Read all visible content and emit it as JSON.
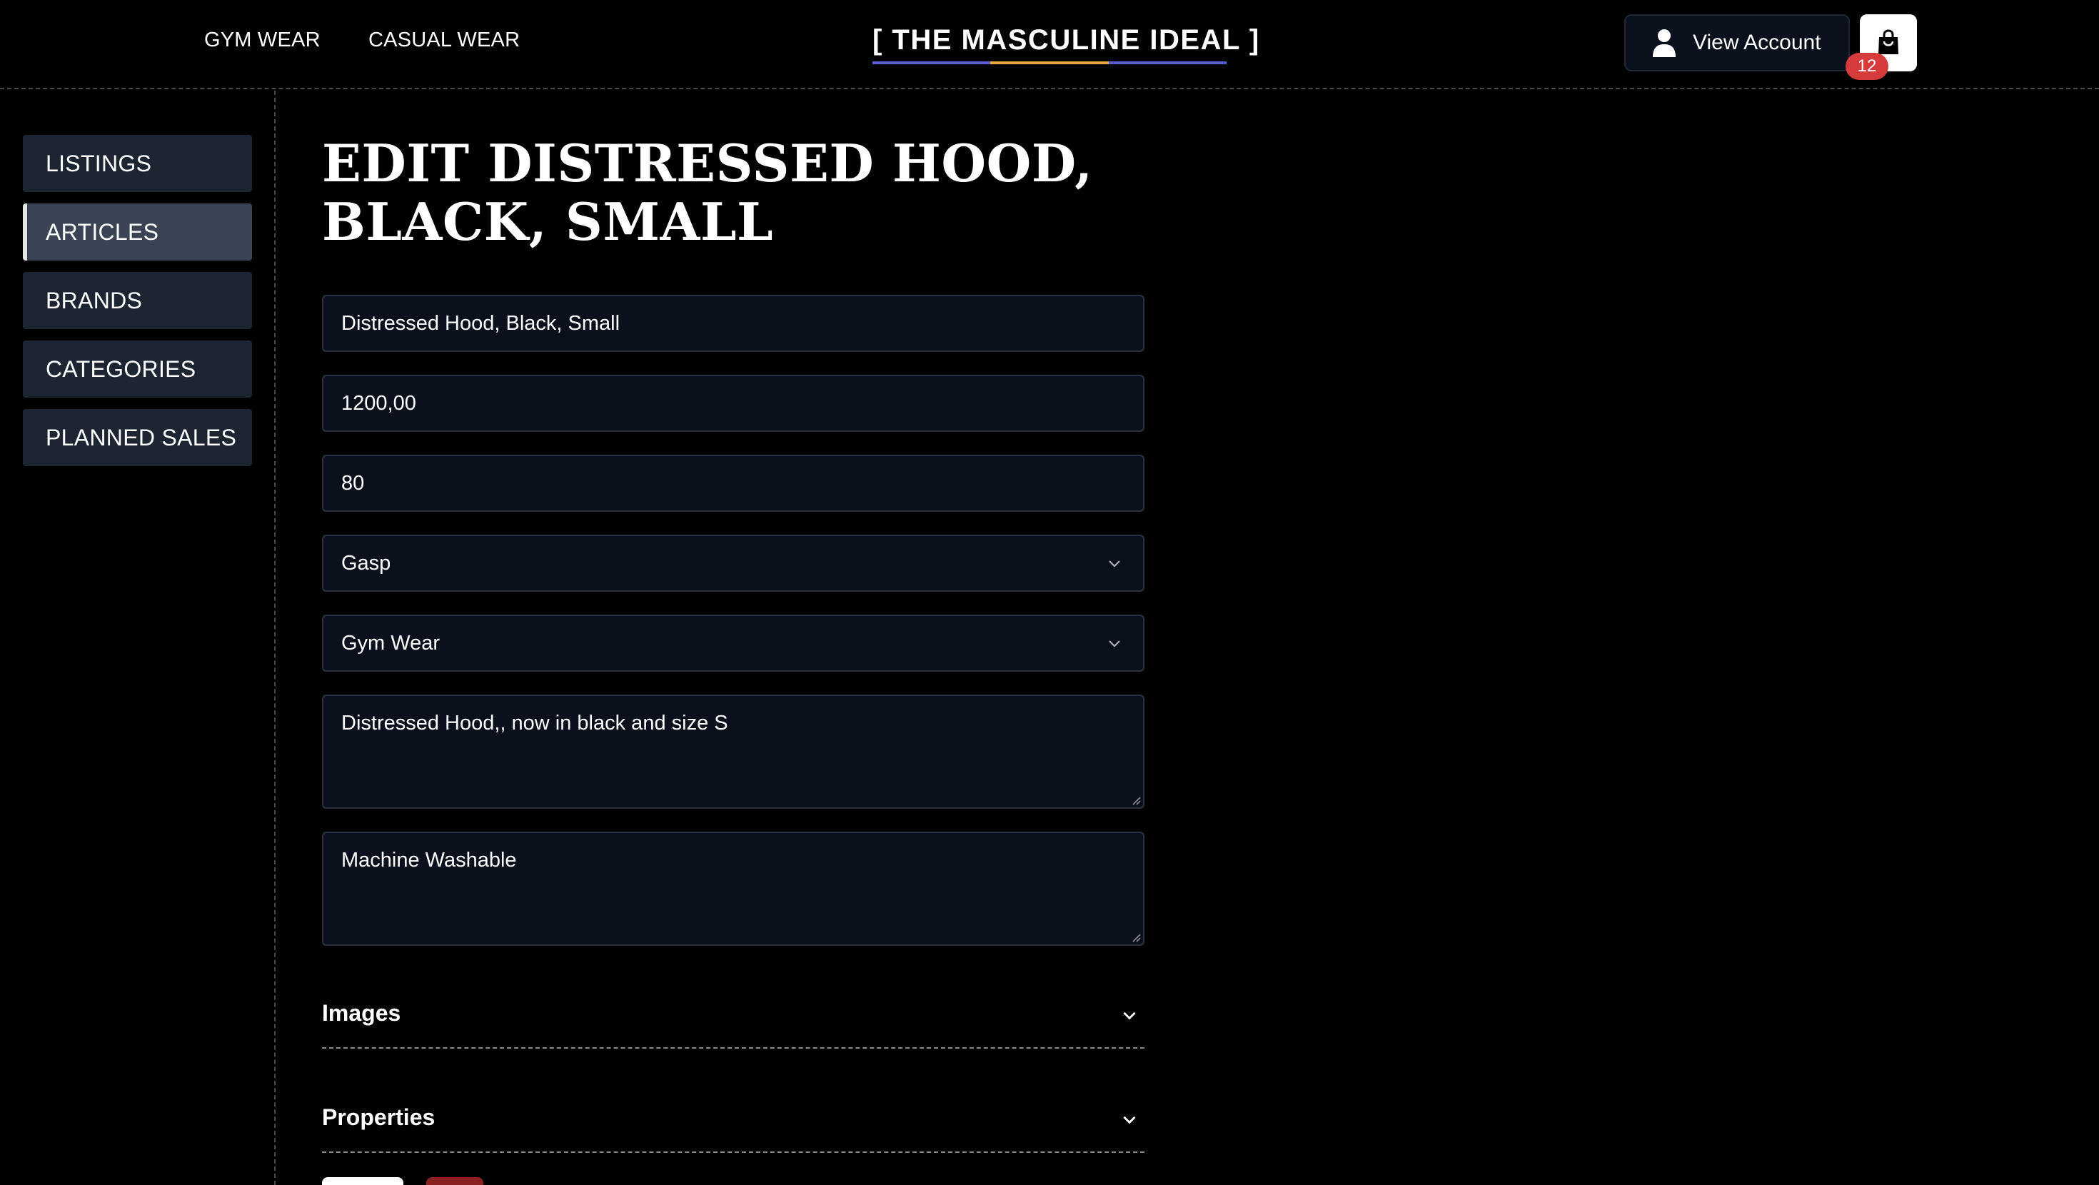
{
  "header": {
    "nav": [
      "GYM WEAR",
      "CASUAL WEAR"
    ],
    "logo": "[ THE MASCULINE IDEAL ]",
    "logo_colors": [
      "#5b5bd6",
      "#e8a93a",
      "#5b5bd6"
    ],
    "account_label": "View Account",
    "cart_count": "12",
    "badge_color": "#d63b3b"
  },
  "sidebar": {
    "items": [
      {
        "label": "LISTINGS"
      },
      {
        "label": "ARTICLES",
        "active": true
      },
      {
        "label": "BRANDS"
      },
      {
        "label": "CATEGORIES"
      },
      {
        "label": "PLANNED SALES"
      }
    ]
  },
  "main": {
    "title_line1": "EDIT DISTRESSED HOOD,",
    "title_line2": "BLACK, SMALL",
    "form": {
      "name": "Distressed Hood, Black, Small",
      "price": "1200,00",
      "stock": "80",
      "brand": "Gasp",
      "category": "Gym Wear",
      "description": "Distressed Hood,, now in black and size S",
      "care": "Machine Washable"
    },
    "sections": [
      "Images",
      "Properties"
    ]
  }
}
